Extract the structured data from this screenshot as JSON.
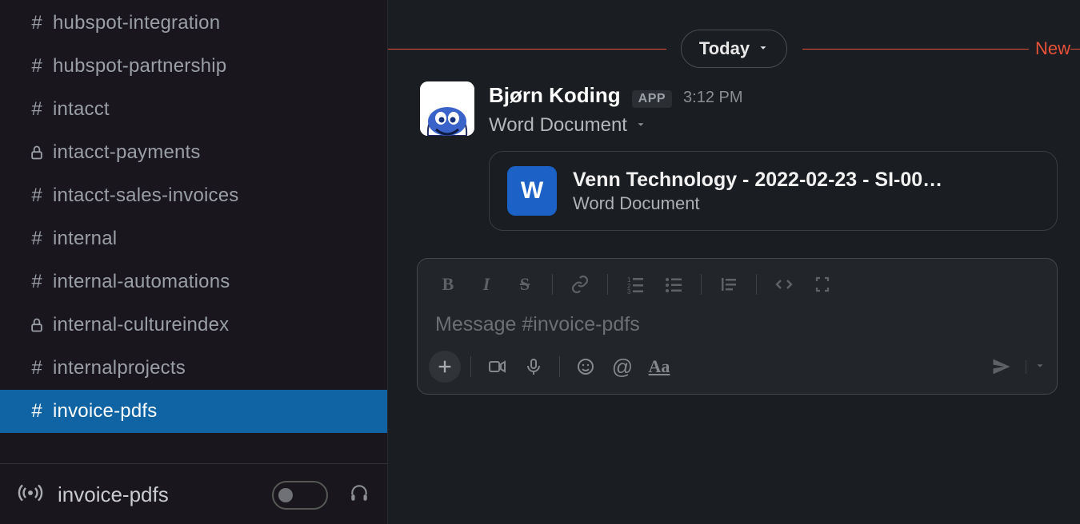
{
  "sidebar": {
    "channels": [
      {
        "icon": "hash",
        "name": "hubspot-integration",
        "active": false
      },
      {
        "icon": "hash",
        "name": "hubspot-partnership",
        "active": false
      },
      {
        "icon": "hash",
        "name": "intacct",
        "active": false
      },
      {
        "icon": "lock",
        "name": "intacct-payments",
        "active": false
      },
      {
        "icon": "hash",
        "name": "intacct-sales-invoices",
        "active": false
      },
      {
        "icon": "hash",
        "name": "internal",
        "active": false
      },
      {
        "icon": "hash",
        "name": "internal-automations",
        "active": false
      },
      {
        "icon": "lock",
        "name": "internal-cultureindex",
        "active": false
      },
      {
        "icon": "hash",
        "name": "internalprojects",
        "active": false
      },
      {
        "icon": "hash",
        "name": "invoice-pdfs",
        "active": true
      }
    ],
    "huddle": {
      "label": "invoice-pdfs"
    }
  },
  "divider": {
    "date_label": "Today",
    "new_label": "New"
  },
  "message": {
    "author": "Bjørn Koding",
    "badge": "APP",
    "time": "3:12 PM",
    "attachment_type": "Word Document",
    "file": {
      "icon_letter": "W",
      "name": "Venn Technology - 2022-02-23 - SI-00…",
      "type": "Word Document"
    }
  },
  "composer": {
    "placeholder": "Message #invoice-pdfs",
    "format_buttons": {
      "bold": "B",
      "italic": "I",
      "strike": "S"
    },
    "aa": "Aa",
    "at": "@"
  }
}
